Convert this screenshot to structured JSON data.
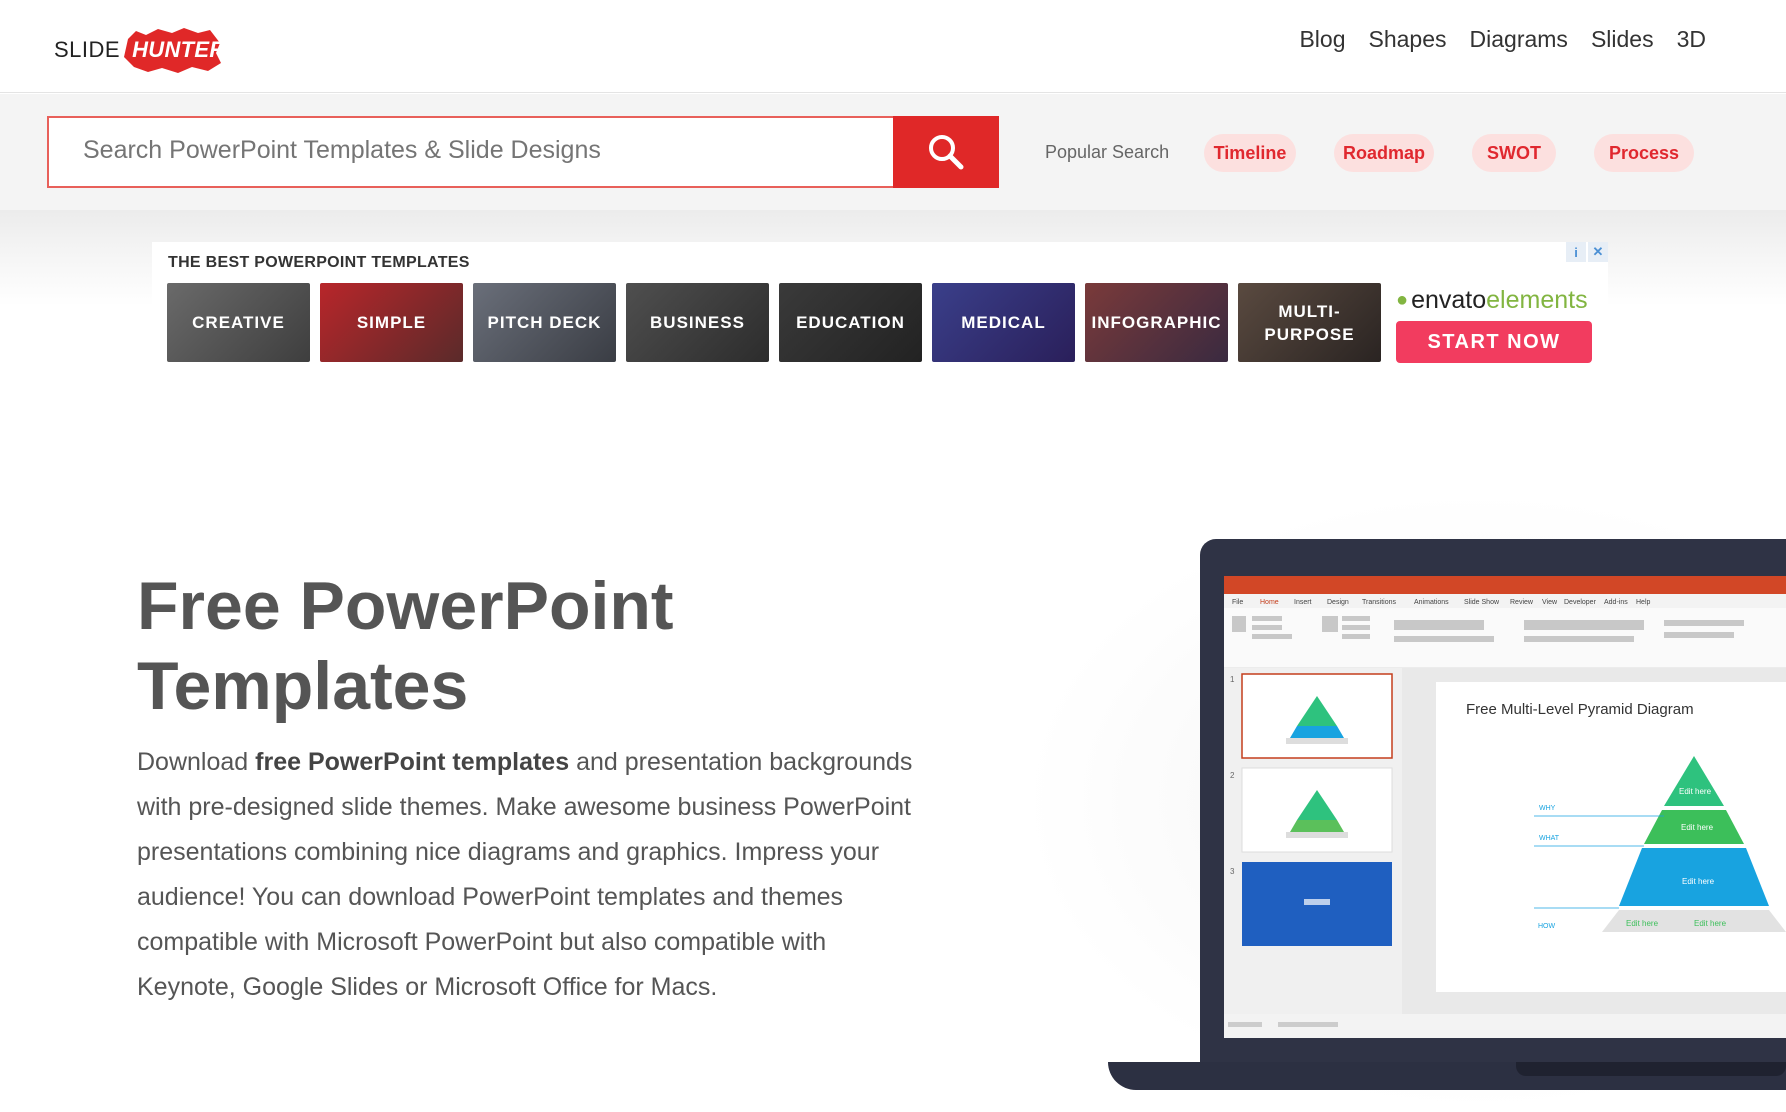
{
  "header": {
    "logo": {
      "part1": "SLIDE",
      "part2": "HUNTER"
    },
    "nav": [
      "Blog",
      "Shapes",
      "Diagrams",
      "Slides",
      "3D"
    ]
  },
  "search": {
    "placeholder": "Search PowerPoint Templates & Slide Designs",
    "button_icon": "search-icon",
    "popular_label": "Popular Search",
    "chips": [
      "Timeline",
      "Roadmap",
      "SWOT",
      "Process"
    ]
  },
  "ad": {
    "title": "THE BEST POWERPOINT TEMPLATES",
    "tiles": [
      "CREATIVE",
      "SIMPLE",
      "PITCH DECK",
      "BUSINESS",
      "EDUCATION",
      "MEDICAL",
      "INFOGRAPHIC",
      "MULTI-PURPOSE"
    ],
    "brand_prefix": "envato",
    "brand_suffix": "elements",
    "cta": "START NOW"
  },
  "hero": {
    "title_line1": "Free PowerPoint",
    "title_line2": "Templates",
    "text_before": "Download ",
    "text_bold": "free PowerPoint templates",
    "text_after": " and presentation backgrounds with pre-designed slide themes. Make awesome business PowerPoint presentations combining nice diagrams and graphics. Impress your audience! You can download PowerPoint templates and themes compatible with Microsoft PowerPoint but also compatible with Keynote, Google Slides or Microsoft Office for Macs."
  },
  "mockup": {
    "menu_tabs": [
      "File",
      "Home",
      "Insert",
      "Design",
      "Transitions",
      "Animations",
      "Slide Show",
      "Review",
      "View",
      "Developer",
      "Add-ins",
      "Help"
    ],
    "slide_title": "Free Multi-Level Pyramid Diagram",
    "labels": [
      "WHY",
      "WHAT",
      "HOW"
    ],
    "edit": "Edit here",
    "thumb_numbers": [
      "1",
      "2",
      "3"
    ]
  },
  "colors": {
    "brand_red": "#e02828",
    "chip_bg": "#fce0df",
    "envato_green": "#82b541",
    "start_now": "#f23c5f"
  }
}
